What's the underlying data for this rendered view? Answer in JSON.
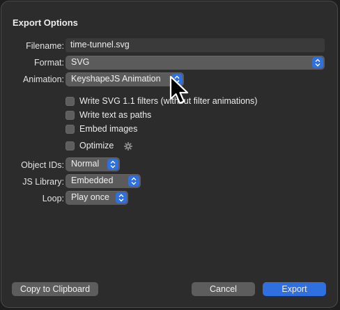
{
  "dialog": {
    "title": "Export Options"
  },
  "form": {
    "filename_label": "Filename:",
    "filename_value": "time-tunnel.svg",
    "format_label": "Format:",
    "format_value": "SVG",
    "animation_label": "Animation:",
    "animation_value": "KeyshapeJS Animation",
    "options": [
      {
        "label": "Write SVG 1.1 filters (without filter animations)",
        "checked": false
      },
      {
        "label": "Write text as paths",
        "checked": false
      },
      {
        "label": "Embed images",
        "checked": false
      },
      {
        "label": "Optimize",
        "checked": false
      }
    ],
    "object_ids_label": "Object IDs:",
    "object_ids_value": "Normal",
    "js_library_label": "JS Library:",
    "js_library_value": "Embedded",
    "loop_label": "Loop:",
    "loop_value": "Play once"
  },
  "footer": {
    "copy_label": "Copy to Clipboard",
    "cancel_label": "Cancel",
    "export_label": "Export"
  },
  "colors": {
    "accent": "#2f6fe0",
    "background": "#2c2c2c",
    "control": "#5b5b5b"
  },
  "icons": {
    "stepper": "up-down-chevron-icon",
    "optimize_settings": "gear-icon",
    "pointer": "mouse-pointer-icon"
  }
}
